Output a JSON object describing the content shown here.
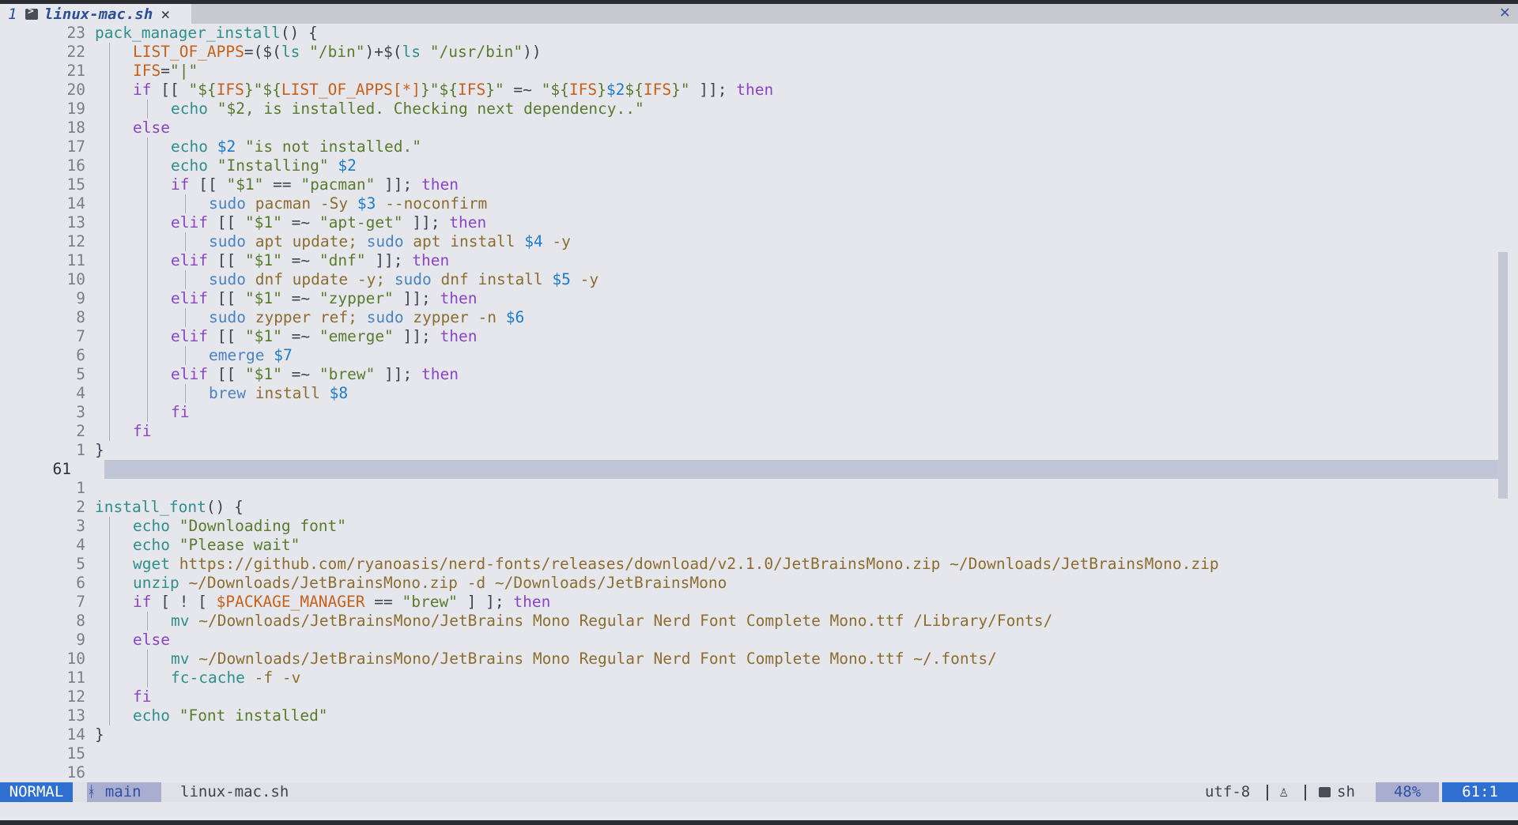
{
  "tab": {
    "number": "1",
    "filename": "linux-mac.sh",
    "close_glyph": "×"
  },
  "window_close_glyph": "✕",
  "editor": {
    "current_line_number": "61",
    "lines": [
      {
        "ln": "23",
        "indent": 0,
        "tokens": [
          [
            "f",
            "pack_manager_install"
          ],
          [
            "o",
            "() {"
          ]
        ]
      },
      {
        "ln": "22",
        "indent": 1,
        "tokens": [
          [
            "v",
            "LIST_OF_APPS"
          ],
          [
            "o",
            "=($("
          ],
          [
            "f",
            "ls"
          ],
          [
            "s",
            " \"/bin\""
          ],
          [
            "o",
            ")+$("
          ],
          [
            "f",
            "ls"
          ],
          [
            "s",
            " \"/usr/bin\""
          ],
          [
            "o",
            "))"
          ]
        ]
      },
      {
        "ln": "21",
        "indent": 1,
        "tokens": [
          [
            "v",
            "IFS"
          ],
          [
            "o",
            "="
          ],
          [
            "s",
            "\"|\""
          ]
        ]
      },
      {
        "ln": "20",
        "indent": 1,
        "tokens": [
          [
            "k",
            "if"
          ],
          [
            "o",
            " [[ "
          ],
          [
            "s",
            "\"${"
          ],
          [
            "v",
            "IFS"
          ],
          [
            "s",
            "}\"${"
          ],
          [
            "v",
            "LIST_OF_APPS[*]"
          ],
          [
            "s",
            "}\"${"
          ],
          [
            "v",
            "IFS"
          ],
          [
            "s",
            "}\""
          ],
          [
            "o",
            " =~ "
          ],
          [
            "s",
            "\"${"
          ],
          [
            "v",
            "IFS"
          ],
          [
            "s",
            "}"
          ],
          [
            "n",
            "$2"
          ],
          [
            "s",
            "${"
          ],
          [
            "v",
            "IFS"
          ],
          [
            "s",
            "}\""
          ],
          [
            "o",
            " ]]; "
          ],
          [
            "k",
            "then"
          ]
        ]
      },
      {
        "ln": "19",
        "indent": 2,
        "tokens": [
          [
            "f",
            "echo"
          ],
          [
            "s",
            " \"$2, is installed. Checking next dependency..\""
          ]
        ]
      },
      {
        "ln": "18",
        "indent": 1,
        "tokens": [
          [
            "k",
            "else"
          ]
        ]
      },
      {
        "ln": "17",
        "indent": 2,
        "tokens": [
          [
            "f",
            "echo"
          ],
          [
            "o",
            " "
          ],
          [
            "n",
            "$2"
          ],
          [
            "s",
            " \"is not installed.\""
          ]
        ]
      },
      {
        "ln": "16",
        "indent": 2,
        "tokens": [
          [
            "f",
            "echo"
          ],
          [
            "s",
            " \"Installing\""
          ],
          [
            "o",
            " "
          ],
          [
            "n",
            "$2"
          ]
        ]
      },
      {
        "ln": "15",
        "indent": 2,
        "tokens": [
          [
            "k",
            "if"
          ],
          [
            "o",
            " [[ "
          ],
          [
            "s",
            "\"$1\""
          ],
          [
            "o",
            " == "
          ],
          [
            "s",
            "\"pacman\""
          ],
          [
            "o",
            " ]]; "
          ],
          [
            "k",
            "then"
          ]
        ]
      },
      {
        "ln": "14",
        "indent": 3,
        "tokens": [
          [
            "c",
            "sudo"
          ],
          [
            "p",
            " pacman -Sy "
          ],
          [
            "n",
            "$3"
          ],
          [
            "p",
            " --noconfirm"
          ]
        ]
      },
      {
        "ln": "13",
        "indent": 2,
        "tokens": [
          [
            "k",
            "elif"
          ],
          [
            "o",
            " [[ "
          ],
          [
            "s",
            "\"$1\""
          ],
          [
            "o",
            " =~ "
          ],
          [
            "s",
            "\"apt-get\""
          ],
          [
            "o",
            " ]]; "
          ],
          [
            "k",
            "then"
          ]
        ]
      },
      {
        "ln": "12",
        "indent": 3,
        "tokens": [
          [
            "c",
            "sudo"
          ],
          [
            "p",
            " apt update; "
          ],
          [
            "c",
            "sudo"
          ],
          [
            "p",
            " apt install "
          ],
          [
            "n",
            "$4"
          ],
          [
            "p",
            " -y"
          ]
        ]
      },
      {
        "ln": "11",
        "indent": 2,
        "tokens": [
          [
            "k",
            "elif"
          ],
          [
            "o",
            " [[ "
          ],
          [
            "s",
            "\"$1\""
          ],
          [
            "o",
            " =~ "
          ],
          [
            "s",
            "\"dnf\""
          ],
          [
            "o",
            " ]]; "
          ],
          [
            "k",
            "then"
          ]
        ]
      },
      {
        "ln": "10",
        "indent": 3,
        "tokens": [
          [
            "c",
            "sudo"
          ],
          [
            "p",
            " dnf update -y; "
          ],
          [
            "c",
            "sudo"
          ],
          [
            "p",
            " dnf install "
          ],
          [
            "n",
            "$5"
          ],
          [
            "p",
            " -y"
          ]
        ]
      },
      {
        "ln": "9",
        "indent": 2,
        "tokens": [
          [
            "k",
            "elif"
          ],
          [
            "o",
            " [[ "
          ],
          [
            "s",
            "\"$1\""
          ],
          [
            "o",
            " =~ "
          ],
          [
            "s",
            "\"zypper\""
          ],
          [
            "o",
            " ]]; "
          ],
          [
            "k",
            "then"
          ]
        ]
      },
      {
        "ln": "8",
        "indent": 3,
        "tokens": [
          [
            "c",
            "sudo"
          ],
          [
            "p",
            " zypper ref; "
          ],
          [
            "c",
            "sudo"
          ],
          [
            "p",
            " zypper -n "
          ],
          [
            "n",
            "$6"
          ]
        ]
      },
      {
        "ln": "7",
        "indent": 2,
        "tokens": [
          [
            "k",
            "elif"
          ],
          [
            "o",
            " [[ "
          ],
          [
            "s",
            "\"$1\""
          ],
          [
            "o",
            " =~ "
          ],
          [
            "s",
            "\"emerge\""
          ],
          [
            "o",
            " ]]; "
          ],
          [
            "k",
            "then"
          ]
        ]
      },
      {
        "ln": "6",
        "indent": 3,
        "tokens": [
          [
            "c",
            "emerge"
          ],
          [
            "o",
            " "
          ],
          [
            "n",
            "$7"
          ]
        ]
      },
      {
        "ln": "5",
        "indent": 2,
        "tokens": [
          [
            "k",
            "elif"
          ],
          [
            "o",
            " [[ "
          ],
          [
            "s",
            "\"$1\""
          ],
          [
            "o",
            " =~ "
          ],
          [
            "s",
            "\"brew\""
          ],
          [
            "o",
            " ]]; "
          ],
          [
            "k",
            "then"
          ]
        ]
      },
      {
        "ln": "4",
        "indent": 3,
        "tokens": [
          [
            "c",
            "brew"
          ],
          [
            "p",
            " install "
          ],
          [
            "n",
            "$8"
          ]
        ]
      },
      {
        "ln": "3",
        "indent": 2,
        "tokens": [
          [
            "k",
            "fi"
          ]
        ]
      },
      {
        "ln": "2",
        "indent": 1,
        "tokens": [
          [
            "k",
            "fi"
          ]
        ]
      },
      {
        "ln": "1",
        "indent": 0,
        "tokens": [
          [
            "o",
            "}"
          ]
        ]
      },
      {
        "ln": "61",
        "indent": 0,
        "current": true,
        "tokens": []
      },
      {
        "ln": "1",
        "indent": 0,
        "tokens": []
      },
      {
        "ln": "2",
        "indent": 0,
        "tokens": [
          [
            "f",
            "install_font"
          ],
          [
            "o",
            "() {"
          ]
        ]
      },
      {
        "ln": "3",
        "indent": 1,
        "tokens": [
          [
            "f",
            "echo"
          ],
          [
            "s",
            " \"Downloading font\""
          ]
        ]
      },
      {
        "ln": "4",
        "indent": 1,
        "tokens": [
          [
            "f",
            "echo"
          ],
          [
            "s",
            " \"Please wait\""
          ]
        ]
      },
      {
        "ln": "5",
        "indent": 1,
        "tokens": [
          [
            "f",
            "wget"
          ],
          [
            "p",
            " https://github.com/ryanoasis/nerd-fonts/releases/download/v2.1.0/JetBrainsMono.zip ~/Downloads/JetBrainsMono.zip"
          ]
        ]
      },
      {
        "ln": "6",
        "indent": 1,
        "tokens": [
          [
            "f",
            "unzip"
          ],
          [
            "p",
            " ~/Downloads/JetBrainsMono.zip -d ~/Downloads/JetBrainsMono"
          ]
        ]
      },
      {
        "ln": "7",
        "indent": 1,
        "tokens": [
          [
            "k",
            "if"
          ],
          [
            "o",
            " [ ! [ "
          ],
          [
            "v",
            "$PACKAGE_MANAGER"
          ],
          [
            "o",
            " == "
          ],
          [
            "s",
            "\"brew\""
          ],
          [
            "o",
            " ] ]; "
          ],
          [
            "k",
            "then"
          ]
        ]
      },
      {
        "ln": "8",
        "indent": 2,
        "tokens": [
          [
            "f",
            "mv"
          ],
          [
            "p",
            " ~/Downloads/JetBrainsMono/JetBrains Mono Regular Nerd Font Complete Mono.ttf /Library/Fonts/"
          ]
        ]
      },
      {
        "ln": "9",
        "indent": 1,
        "tokens": [
          [
            "k",
            "else"
          ]
        ]
      },
      {
        "ln": "10",
        "indent": 2,
        "tokens": [
          [
            "f",
            "mv"
          ],
          [
            "p",
            " ~/Downloads/JetBrainsMono/JetBrains Mono Regular Nerd Font Complete Mono.ttf ~/.fonts/"
          ]
        ]
      },
      {
        "ln": "11",
        "indent": 2,
        "tokens": [
          [
            "f",
            "fc-cache"
          ],
          [
            "p",
            " -f -v"
          ]
        ]
      },
      {
        "ln": "12",
        "indent": 1,
        "tokens": [
          [
            "k",
            "fi"
          ]
        ]
      },
      {
        "ln": "13",
        "indent": 1,
        "tokens": [
          [
            "f",
            "echo"
          ],
          [
            "s",
            " \"Font installed\""
          ]
        ]
      },
      {
        "ln": "14",
        "indent": 0,
        "tokens": [
          [
            "o",
            "}"
          ]
        ]
      },
      {
        "ln": "15",
        "indent": 0,
        "tokens": []
      },
      {
        "ln": "16",
        "indent": 0,
        "tokens": []
      }
    ]
  },
  "statusline": {
    "mode": "NORMAL",
    "branch": "main",
    "branch_icon": "git-branch-icon",
    "filename": "linux-mac.sh",
    "encoding": "utf-8",
    "os_icon": "linux-penguin-icon",
    "filetype": "sh",
    "percent": "48%",
    "position": "61:1"
  },
  "colors": {
    "background": "#e6e7ec",
    "keyword": "#8b45c4",
    "function": "#2e8f8c",
    "string": "#5a7a2e",
    "variable": "#c5611a",
    "number_param": "#1d7bcc",
    "mode_bg": "#2f6fd0",
    "cursorline": "#c0c5d8"
  }
}
